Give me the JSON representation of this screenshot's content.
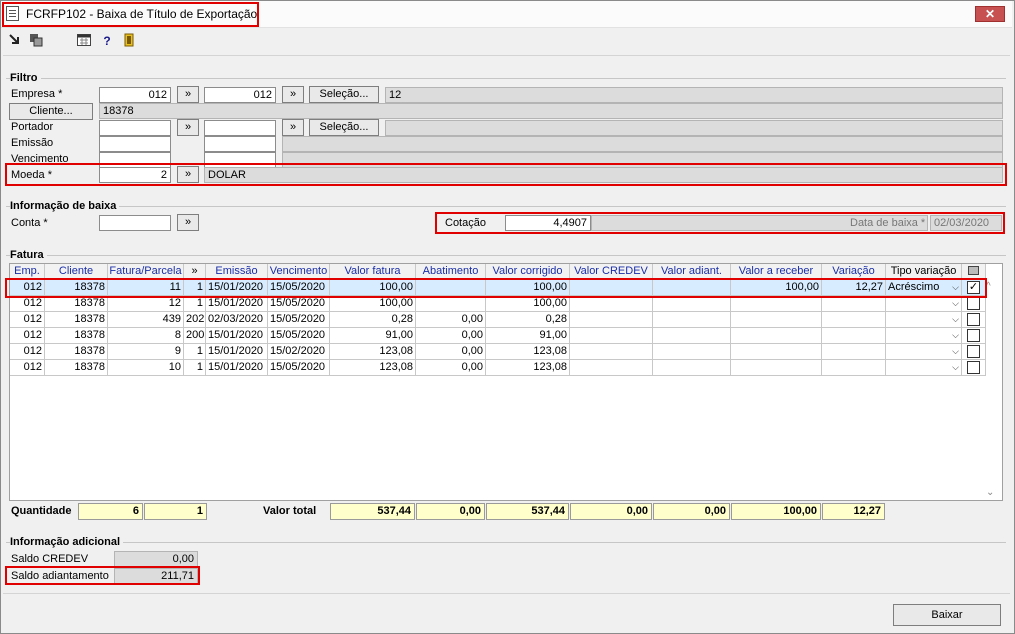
{
  "window": {
    "title": "FCRFP102 - Baixa de Título de Exportação",
    "close": "✕"
  },
  "toolbar": {
    "icons": [
      "arrow-icon",
      "copy-icon",
      "calendar-icon",
      "help-icon",
      "exit-door-icon"
    ],
    "help_glyph": "?"
  },
  "filtro": {
    "title": "Filtro",
    "empresa_label": "Empresa *",
    "empresa_from": "012",
    "empresa_to": "012",
    "empresa_desc": "12",
    "selecao_label": "Seleção...",
    "cliente_button": "Cliente...",
    "cliente_value": "18378",
    "portador_label": "Portador",
    "emissao_label": "Emissão",
    "vencimento_label": "Vencimento",
    "moeda_label": "Moeda *",
    "moeda_value": "2",
    "moeda_desc": "DOLAR",
    "lookup_glyph": "»"
  },
  "baixa": {
    "title": "Informação de baixa",
    "conta_label": "Conta *",
    "cotacao_label": "Cotação",
    "cotacao_value": "4,4907",
    "data_label": "Data de baixa *",
    "data_value": "02/03/2020"
  },
  "fatura": {
    "title": "Fatura",
    "headers": [
      "Emp.",
      "Cliente",
      "Fatura/Parcela",
      "»",
      "Emissão",
      "Vencimento",
      "Valor fatura",
      "Abatimento",
      "Valor corrigido",
      "Valor CREDEV",
      "Valor adiant.",
      "Valor a receber",
      "Variação",
      "Tipo variação",
      ""
    ],
    "rows": [
      {
        "emp": "012",
        "cliente": "18378",
        "fatura": "11",
        "parcela": "1",
        "emissao": "15/01/2020",
        "vencimento": "15/05/2020",
        "valor_fatura": "100,00",
        "abatimento": "",
        "valor_corrigido": "100,00",
        "credev": "",
        "adiant": "",
        "receber": "100,00",
        "variacao": "12,27",
        "tipo": "Acréscimo",
        "checked": "✓"
      },
      {
        "emp": "012",
        "cliente": "18378",
        "fatura": "12",
        "parcela": "1",
        "emissao": "15/01/2020",
        "vencimento": "15/05/2020",
        "valor_fatura": "100,00",
        "abatimento": "",
        "valor_corrigido": "100,00",
        "credev": "",
        "adiant": "",
        "receber": "",
        "variacao": "",
        "tipo": "",
        "checked": ""
      },
      {
        "emp": "012",
        "cliente": "18378",
        "fatura": "439",
        "parcela": "202",
        "emissao": "02/03/2020",
        "vencimento": "15/05/2020",
        "valor_fatura": "0,28",
        "abatimento": "0,00",
        "valor_corrigido": "0,28",
        "credev": "",
        "adiant": "",
        "receber": "",
        "variacao": "",
        "tipo": "",
        "checked": ""
      },
      {
        "emp": "012",
        "cliente": "18378",
        "fatura": "8",
        "parcela": "200",
        "emissao": "15/01/2020",
        "vencimento": "15/05/2020",
        "valor_fatura": "91,00",
        "abatimento": "0,00",
        "valor_corrigido": "91,00",
        "credev": "",
        "adiant": "",
        "receber": "",
        "variacao": "",
        "tipo": "",
        "checked": ""
      },
      {
        "emp": "012",
        "cliente": "18378",
        "fatura": "9",
        "parcela": "1",
        "emissao": "15/01/2020",
        "vencimento": "15/02/2020",
        "valor_fatura": "123,08",
        "abatimento": "0,00",
        "valor_corrigido": "123,08",
        "credev": "",
        "adiant": "",
        "receber": "",
        "variacao": "",
        "tipo": "",
        "checked": ""
      },
      {
        "emp": "012",
        "cliente": "18378",
        "fatura": "10",
        "parcela": "1",
        "emissao": "15/01/2020",
        "vencimento": "15/05/2020",
        "valor_fatura": "123,08",
        "abatimento": "0,00",
        "valor_corrigido": "123,08",
        "credev": "",
        "adiant": "",
        "receber": "",
        "variacao": "",
        "tipo": "",
        "checked": ""
      }
    ],
    "dropdown_glyph": "⌵",
    "scroll_up": "^",
    "scroll_down": "⌄"
  },
  "totais": {
    "quantidade_label": "Quantidade",
    "quantidade": "6",
    "quantidade_sel": "1",
    "valor_total_label": "Valor total",
    "valor_fatura": "537,44",
    "abatimento": "0,00",
    "valor_corrigido": "537,44",
    "credev": "0,00",
    "adiant": "0,00",
    "receber": "100,00",
    "variacao": "12,27"
  },
  "adicional": {
    "title": "Informação adicional",
    "saldo_credev_label": "Saldo CREDEV",
    "saldo_credev": "0,00",
    "saldo_adiant_label": "Saldo adiantamento",
    "saldo_adiant": "211,71"
  },
  "footer": {
    "baixar": "Baixar"
  }
}
